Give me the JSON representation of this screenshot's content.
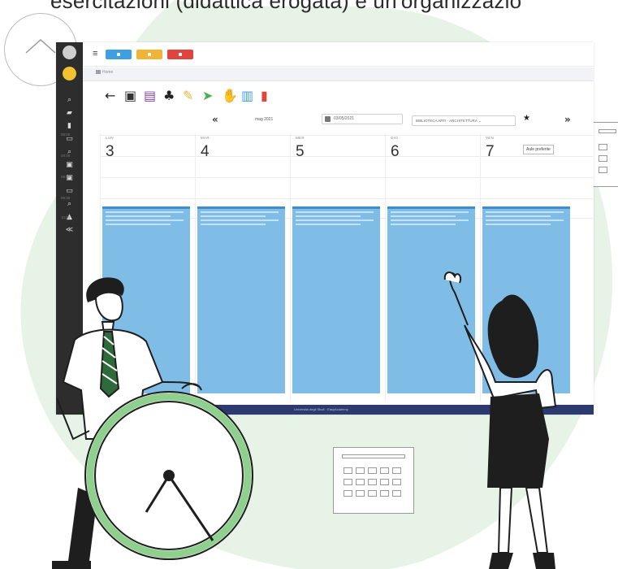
{
  "header_text": "esercitazioni (didattica erogata) e un'organizzazio",
  "scroll_up": {
    "icon": "chevron-up-icon"
  },
  "app": {
    "sidebar": {
      "icons": [
        "search-icon",
        "map-icon",
        "book-icon",
        "list-icon",
        "search-icon",
        "grid-icon",
        "grid-icon",
        "list-icon",
        "search-icon",
        "warning-icon",
        "share-icon"
      ]
    },
    "topbar": {
      "menu_icon": "≡",
      "buttons": [
        {
          "name": "blue-button",
          "color": "#3ea0e0"
        },
        {
          "name": "yellow-button",
          "color": "#f2b437"
        },
        {
          "name": "red-button",
          "color": "#e0453d"
        }
      ]
    },
    "breadcrumb": "Home",
    "toolbar": {
      "tools": [
        {
          "name": "back-arrow-icon",
          "glyph": "←",
          "color": "#222222"
        },
        {
          "name": "calendar-icon",
          "glyph": "▣",
          "color": "#333333"
        },
        {
          "name": "document-icon",
          "glyph": "▤",
          "color": "#8e44ad"
        },
        {
          "name": "users-icon",
          "glyph": "♣",
          "color": "#222222"
        },
        {
          "name": "pin-icon",
          "glyph": "✎",
          "color": "#f2b437"
        },
        {
          "name": "send-icon",
          "glyph": "➤",
          "color": "#4caf50"
        },
        {
          "name": "hand-icon",
          "glyph": "✋",
          "color": "#f2b437"
        },
        {
          "name": "copy-icon",
          "glyph": "▥",
          "color": "#3ea0e0"
        },
        {
          "name": "trash-icon",
          "glyph": "▮",
          "color": "#e0453d"
        }
      ]
    },
    "nav": {
      "prev": "«",
      "month": "mag 2021",
      "date_value": "03/05/2021",
      "room": "BIBLIOTECA ARTI - ARCHITETTURA",
      "star": "★",
      "next": "»",
      "tooltip": "Aule preferite"
    },
    "hours": [
      "08:00",
      "08:30",
      "09:00",
      "09:30",
      "10:00"
    ],
    "days": [
      {
        "name": "LUN",
        "number": "3"
      },
      {
        "name": "MAR",
        "number": "4"
      },
      {
        "name": "MER",
        "number": "5"
      },
      {
        "name": "GIO",
        "number": "6"
      },
      {
        "name": "VEN",
        "number": "7"
      }
    ],
    "footer": "Università degli Studi · EasyAcademy"
  }
}
